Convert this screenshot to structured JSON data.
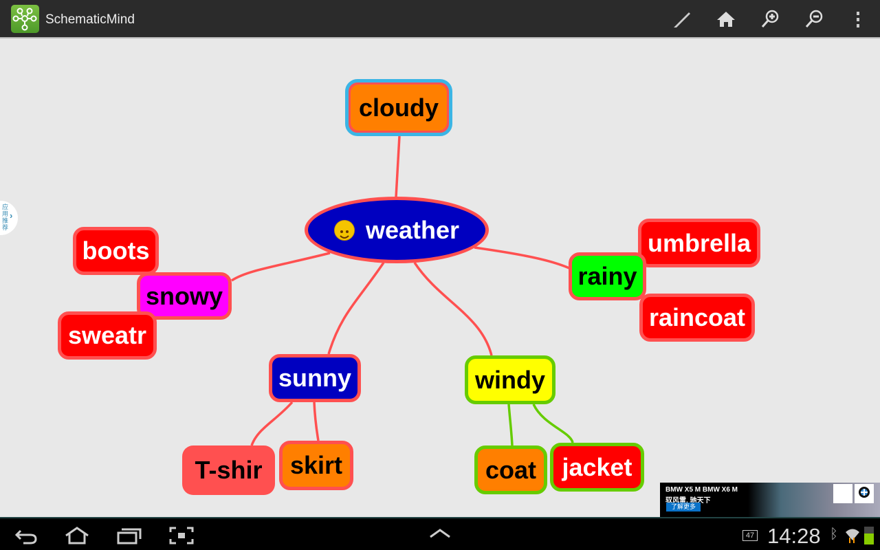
{
  "app": {
    "title": "SchematicMind",
    "toolbar": [
      "brush-icon",
      "home-icon",
      "zoom-in-icon",
      "zoom-out-icon",
      "overflow-menu-icon"
    ]
  },
  "side_tab": {
    "label": "应用推荐"
  },
  "mindmap": {
    "center": "weather",
    "nodes": {
      "cloudy": "cloudy",
      "boots": "boots",
      "snowy": "snowy",
      "sweatr": "sweatr",
      "umbrella": "umbrella",
      "rainy": "rainy",
      "raincoat": "raincoat",
      "sunny": "sunny",
      "windy": "windy",
      "tshirt": "T-shir",
      "skirt": "skirt",
      "coat": "coat",
      "jacket": "jacket"
    }
  },
  "ad": {
    "headline": "BMW X5 M  BMW X6 M",
    "slogan": "驭风雷, 驰天下",
    "cta": "了解更多"
  },
  "status": {
    "time": "14:28",
    "notification_count": "47"
  }
}
